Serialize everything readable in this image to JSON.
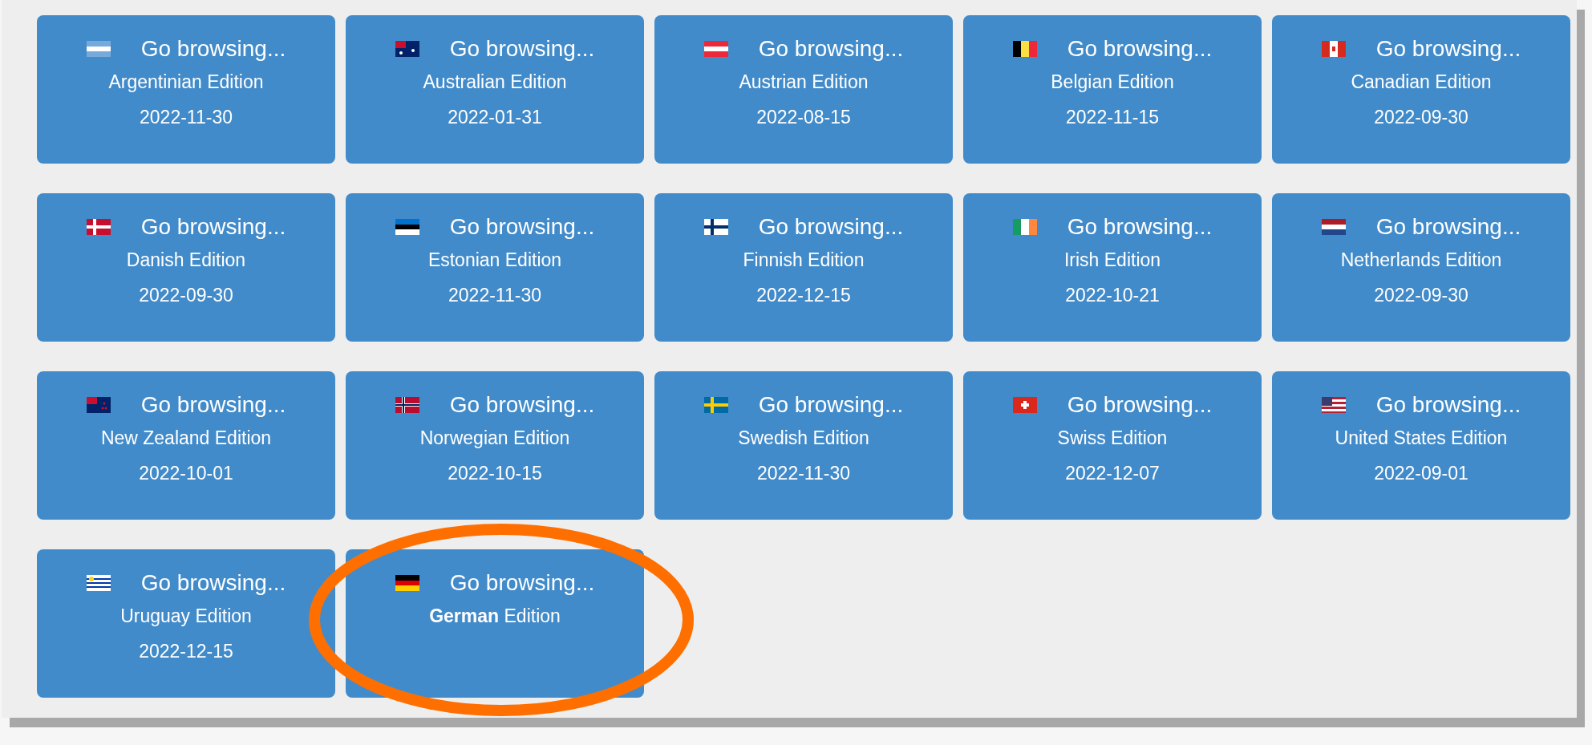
{
  "cards": [
    {
      "action": "Go browsing...",
      "edition": "Argentinian Edition",
      "date": "2022-11-30",
      "highlighted": false
    },
    {
      "action": "Go browsing...",
      "edition": "Australian Edition",
      "date": "2022-01-31",
      "highlighted": false
    },
    {
      "action": "Go browsing...",
      "edition": "Austrian Edition",
      "date": "2022-08-15",
      "highlighted": false
    },
    {
      "action": "Go browsing...",
      "edition": "Belgian Edition",
      "date": "2022-11-15",
      "highlighted": false
    },
    {
      "action": "Go browsing...",
      "edition": "Canadian Edition",
      "date": "2022-09-30",
      "highlighted": false
    },
    {
      "action": "Go browsing...",
      "edition": "Danish Edition",
      "date": "2022-09-30",
      "highlighted": false
    },
    {
      "action": "Go browsing...",
      "edition": "Estonian Edition",
      "date": "2022-11-30",
      "highlighted": false
    },
    {
      "action": "Go browsing...",
      "edition": "Finnish Edition",
      "date": "2022-12-15",
      "highlighted": false
    },
    {
      "action": "Go browsing...",
      "edition": "Irish Edition",
      "date": "2022-10-21",
      "highlighted": false
    },
    {
      "action": "Go browsing...",
      "edition": "Netherlands Edition",
      "date": "2022-09-30",
      "highlighted": false
    },
    {
      "action": "Go browsing...",
      "edition": "New Zealand Edition",
      "date": "2022-10-01",
      "highlighted": false
    },
    {
      "action": "Go browsing...",
      "edition": "Norwegian Edition",
      "date": "2022-10-15",
      "highlighted": false
    },
    {
      "action": "Go browsing...",
      "edition": "Swedish Edition",
      "date": "2022-11-30",
      "highlighted": false
    },
    {
      "action": "Go browsing...",
      "edition": "Swiss Edition",
      "date": "2022-12-07",
      "highlighted": false
    },
    {
      "action": "Go browsing...",
      "edition": "United States Edition",
      "date": "2022-09-01",
      "highlighted": false
    },
    {
      "action": "Go browsing...",
      "edition": "Uruguay Edition",
      "date": "2022-12-15",
      "highlighted": false
    },
    {
      "action": "Go browsing...",
      "edition": "**German** Edition",
      "highlighted": true
    }
  ]
}
